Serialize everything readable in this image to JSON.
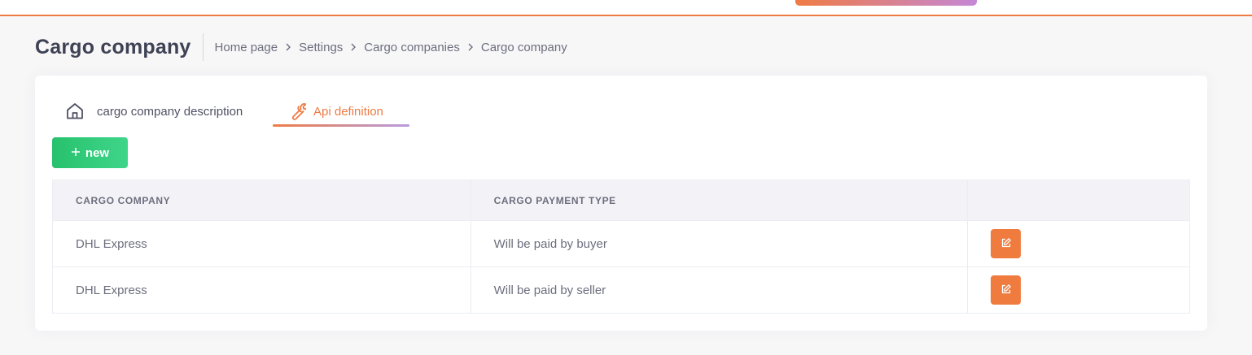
{
  "header": {
    "title": "Cargo company",
    "breadcrumbs": [
      "Home page",
      "Settings",
      "Cargo companies",
      "Cargo company"
    ]
  },
  "tabs": [
    {
      "label": "cargo company description",
      "icon": "home-icon",
      "active": false
    },
    {
      "label": "Api definition",
      "icon": "wrench-icon",
      "active": true
    }
  ],
  "toolbar": {
    "new_label": "new",
    "new_icon": "plus-icon"
  },
  "table": {
    "columns": [
      "CARGO COMPANY",
      "CARGO PAYMENT TYPE",
      ""
    ],
    "rows": [
      {
        "company": "DHL Express",
        "payment_type": "Will be paid by buyer",
        "action_icon": "edit-icon"
      },
      {
        "company": "DHL Express",
        "payment_type": "Will be paid by seller",
        "action_icon": "edit-icon"
      }
    ]
  },
  "colors": {
    "accent": "#ef7b45",
    "success": "#27c26d",
    "edit_button": "#ef7b3f"
  }
}
